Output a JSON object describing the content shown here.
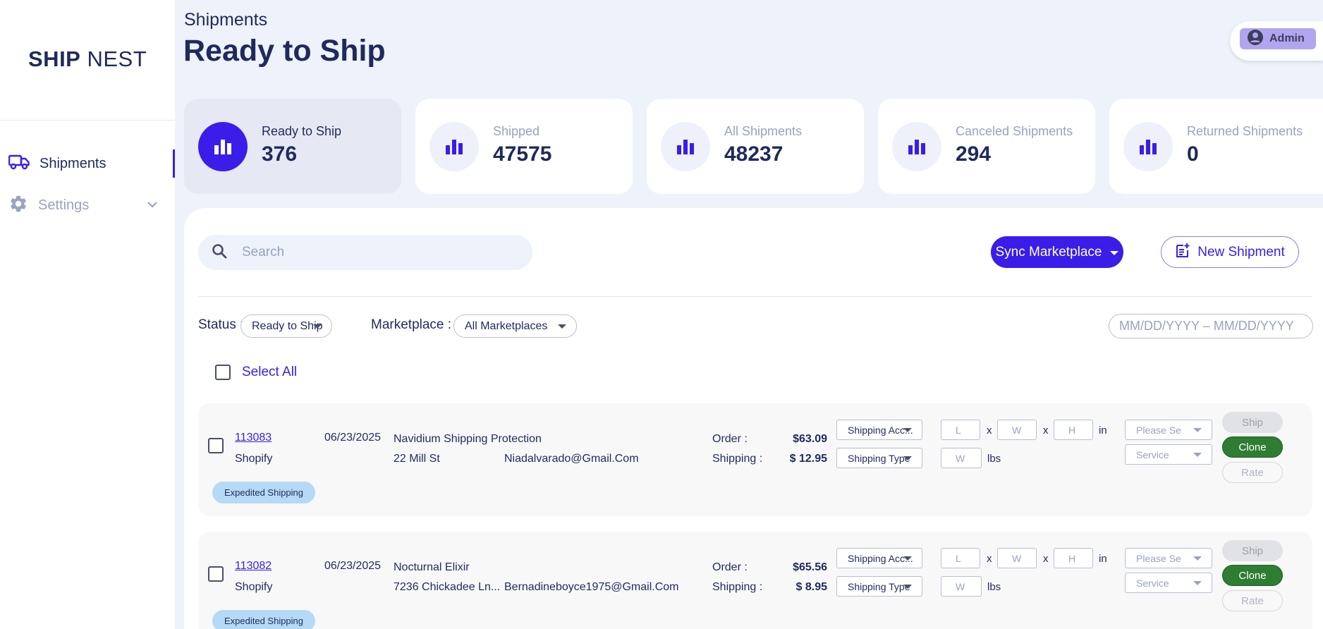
{
  "brand": {
    "name_bold": "SHIP",
    "name_light": "NEST"
  },
  "sidebar": {
    "items": [
      {
        "label": "Shipments",
        "icon": "truck-icon",
        "active": true
      },
      {
        "label": "Settings",
        "icon": "gear-icon",
        "active": false
      }
    ]
  },
  "header": {
    "breadcrumb": "Shipments",
    "title": "Ready to Ship",
    "user_label": "Admin"
  },
  "stats": [
    {
      "label": "Ready to Ship",
      "value": "376",
      "active": true
    },
    {
      "label": "Shipped",
      "value": "47575",
      "active": false
    },
    {
      "label": "All Shipments",
      "value": "48237",
      "active": false
    },
    {
      "label": "Canceled Shipments",
      "value": "294",
      "active": false
    },
    {
      "label": "Returned Shipments",
      "value": "0",
      "active": false
    }
  ],
  "toolbar": {
    "search_placeholder": "Search",
    "sync_label": "Sync Marketplace",
    "new_label": "New Shipment"
  },
  "filters": {
    "status_label": "Status :",
    "status_value": "Ready to Ship",
    "marketplace_label": "Marketplace :",
    "marketplace_value": "All Marketplaces",
    "date_placeholder": "MM/DD/YYYY – MM/DD/YYYY"
  },
  "select_all_label": "Select All",
  "row_labels": {
    "order": "Order :",
    "shipping": "Shipping :",
    "shipping_account": "Shipping Acc...",
    "shipping_type": "Shipping Type",
    "length": "L",
    "width": "W",
    "height": "H",
    "weight": "W",
    "x": "x",
    "in": "in",
    "lbs": "lbs",
    "please_select": "Please Se",
    "service": "Service",
    "ship": "Ship",
    "clone": "Clone",
    "rate": "Rate"
  },
  "shipments": [
    {
      "id": "113083",
      "marketplace": "Shopify",
      "date": "06/23/2025",
      "product": "Navidium Shipping Protection",
      "address": "22 Mill St",
      "email": "Niadalvarado@Gmail.Com",
      "order_total": "$63.09",
      "shipping_total": "$ 12.95",
      "badge": "Expedited Shipping"
    },
    {
      "id": "113082",
      "marketplace": "Shopify",
      "date": "06/23/2025",
      "product": "Nocturnal Elixir",
      "address": "7236 Chickadee Ln...",
      "email": "Bernadineboyce1975@Gmail.Com",
      "order_total": "$65.56",
      "shipping_total": "$ 8.95",
      "badge": "Expedited Shipping"
    }
  ],
  "colors": {
    "accent": "#3a1de8",
    "navy": "#1f2a5c",
    "clone_green": "#2e7d32",
    "badge_blue": "#b6daf6"
  }
}
